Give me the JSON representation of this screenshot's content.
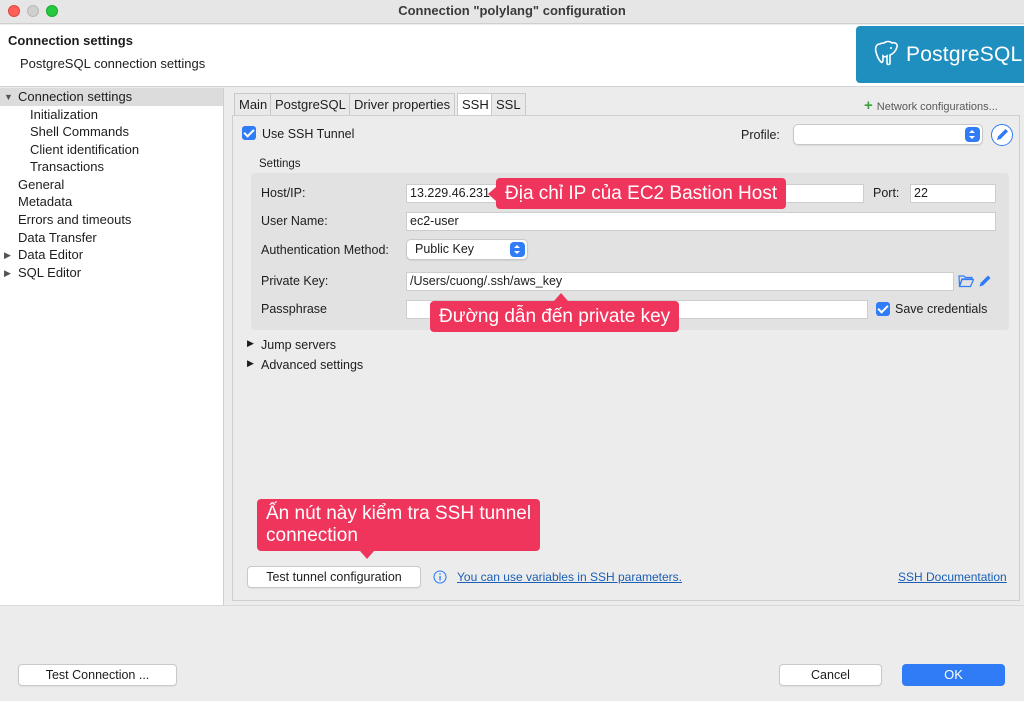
{
  "window": {
    "title": "Connection \"polylang\" configuration"
  },
  "header": {
    "title": "Connection settings",
    "subtitle": "PostgreSQL connection settings",
    "logo_text": "PostgreSQL"
  },
  "sidebar": {
    "items": [
      {
        "label": "Connection settings"
      },
      {
        "label": "Initialization"
      },
      {
        "label": "Shell Commands"
      },
      {
        "label": "Client identification"
      },
      {
        "label": "Transactions"
      },
      {
        "label": "General"
      },
      {
        "label": "Metadata"
      },
      {
        "label": "Errors and timeouts"
      },
      {
        "label": "Data Transfer"
      },
      {
        "label": "Data Editor"
      },
      {
        "label": "SQL Editor"
      }
    ]
  },
  "tabs": [
    {
      "label": "Main"
    },
    {
      "label": "PostgreSQL"
    },
    {
      "label": "Driver properties"
    },
    {
      "label": "SSH"
    },
    {
      "label": "SSL"
    }
  ],
  "network_config": "Network configurations...",
  "ssh": {
    "use_tunnel_label": "Use SSH Tunnel",
    "profile_label": "Profile:",
    "profile_value": "",
    "settings_title": "Settings",
    "host_label": "Host/IP:",
    "host_value": "13.229.46.231",
    "port_label": "Port:",
    "port_value": "22",
    "user_label": "User Name:",
    "user_value": "ec2-user",
    "auth_label": "Authentication Method:",
    "auth_value": "Public Key",
    "key_label": "Private Key:",
    "key_value": "/Users/cuong/.ssh/aws_key",
    "pass_label": "Passphrase",
    "pass_value": "",
    "save_credentials": "Save credentials",
    "jump_servers": "Jump servers",
    "advanced_settings": "Advanced settings",
    "test_tunnel": "Test tunnel configuration",
    "variables_link": "You can use variables in SSH parameters.",
    "docs_link": "SSH Documentation"
  },
  "callouts": {
    "ip": "Địa chỉ IP của EC2 Bastion Host",
    "key": "Đường dẫn đến private key",
    "test_line1": "Ấn nút này kiểm tra SSH tunnel",
    "test_line2": "connection"
  },
  "footer": {
    "test_connection": "Test Connection ...",
    "cancel": "Cancel",
    "ok": "OK"
  }
}
